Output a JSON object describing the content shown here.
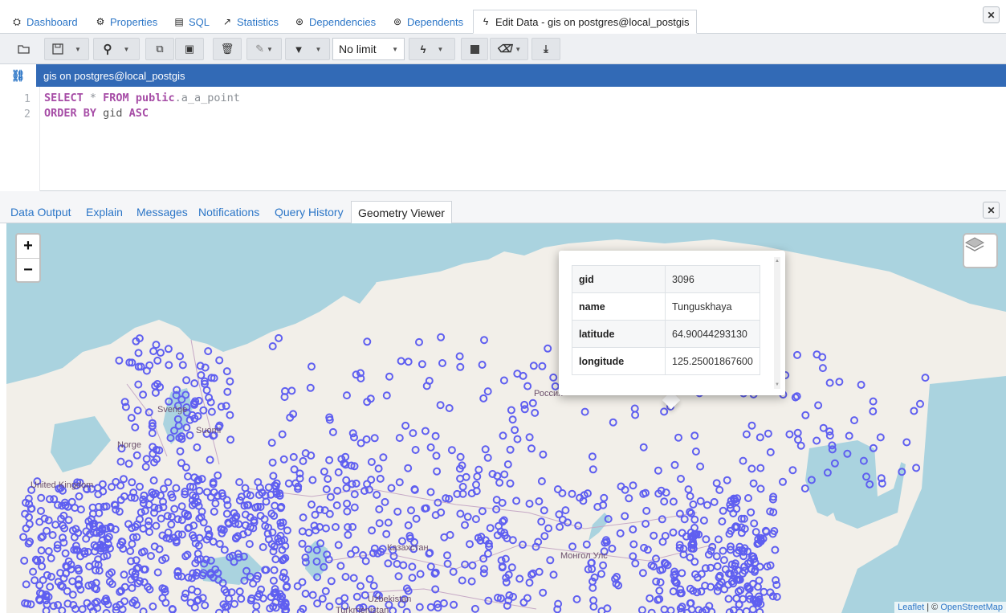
{
  "tabs": [
    {
      "icon": "dashboard-icon",
      "label": "Dashboard",
      "active": false
    },
    {
      "icon": "properties-icon",
      "label": "Properties",
      "active": false
    },
    {
      "icon": "sql-icon",
      "label": "SQL",
      "active": false
    },
    {
      "icon": "statistics-icon",
      "label": "Statistics",
      "active": false
    },
    {
      "icon": "dependencies-icon",
      "label": "Dependencies",
      "active": false
    },
    {
      "icon": "dependents-icon",
      "label": "Dependents",
      "active": false
    },
    {
      "icon": "lightning-icon",
      "label": "Edit Data - gis on postgres@local_postgis",
      "active": true
    }
  ],
  "toolbar": {
    "row_limit": "No limit"
  },
  "connection": {
    "label": "gis on postgres@local_postgis"
  },
  "editor": {
    "line_numbers": [
      "1",
      "2"
    ],
    "line1": {
      "kw1": "SELECT",
      "star": " * ",
      "kw2": "FROM",
      "schema": " public",
      "dot": ".",
      "table": "a_a_point"
    },
    "line2": {
      "kw1": "ORDER BY",
      "col": " gid ",
      "kw2": "ASC"
    }
  },
  "result_tabs": [
    "Data Output",
    "Explain",
    "Messages",
    "Notifications",
    "Query History",
    "Geometry Viewer"
  ],
  "active_result_tab": "Geometry Viewer",
  "map": {
    "zoom_in": "+",
    "zoom_out": "−",
    "labels": {
      "sweden": "Sverige",
      "suomi": "Suomi",
      "norge": "Norge",
      "uk": "United Kingdom",
      "russia": "Россия",
      "kazakhstan": "Казахстан",
      "mongolia": "Монгол Улс",
      "turkmenistan": "Turkmenistan",
      "uzbekistan": "Uzbekistan"
    },
    "attribution": {
      "leaflet": "Leaflet",
      "sep": " | © ",
      "osm": "OpenStreetMap"
    },
    "marker_color": "#5f5ff0",
    "land_color": "#f2efe9",
    "water_color": "#aad3df"
  },
  "popup": {
    "rows": [
      {
        "key": "gid",
        "value": "3096"
      },
      {
        "key": "name",
        "value": "Tunguskhaya"
      },
      {
        "key": "latitude",
        "value": "64.90044293130"
      },
      {
        "key": "longitude",
        "value": "125.25001867600"
      }
    ]
  }
}
